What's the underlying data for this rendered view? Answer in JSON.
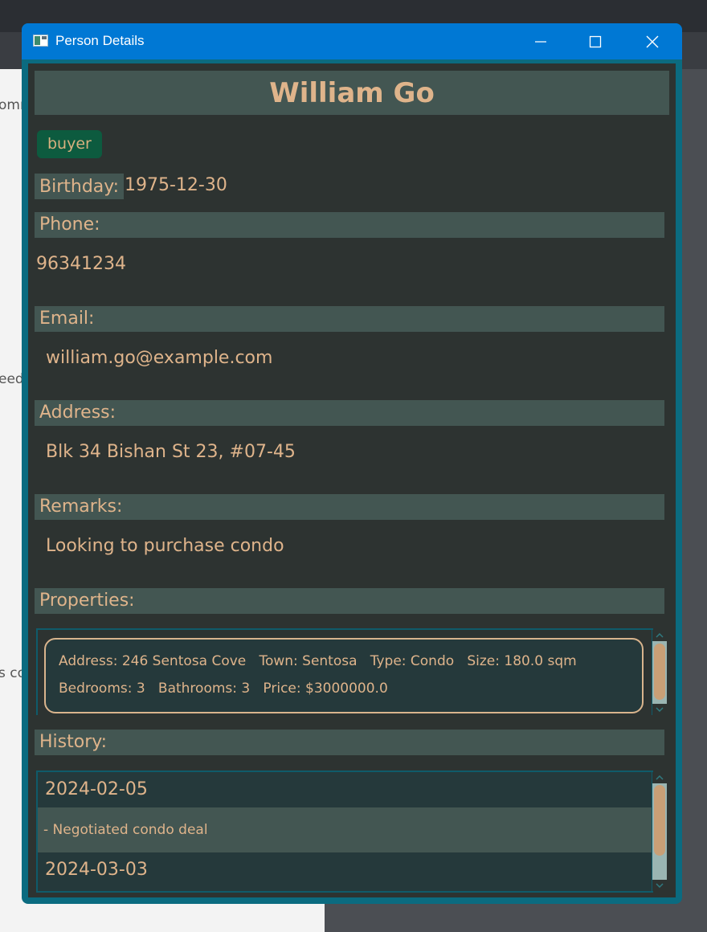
{
  "window": {
    "title": "Person Details"
  },
  "background_fragments": [
    "omm",
    "eed",
    "s co"
  ],
  "person": {
    "name": "William Go",
    "tags": [
      "buyer"
    ],
    "birthday_label": "Birthday:",
    "birthday": "1975-12-30",
    "phone_label": "Phone:",
    "phone": "96341234",
    "email_label": "Email:",
    "email": "william.go@example.com",
    "address_label": "Address:",
    "address": "Blk 34 Bishan St 23, #07-45",
    "remarks_label": "Remarks:",
    "remarks": "Looking to purchase condo",
    "properties_label": "Properties:",
    "properties": [
      {
        "line1": "Address: 246 Sentosa Cove   Town: Sentosa   Type: Condo   Size: 180.0 sqm",
        "line2": "Bedrooms: 3   Bathrooms: 3   Price: $3000000.0"
      }
    ],
    "history_label": "History:",
    "history": [
      {
        "date": "2024-02-05",
        "note": "- Negotiated condo deal"
      },
      {
        "date": "2024-03-03"
      }
    ]
  },
  "colors": {
    "text_accent": "#dfb48b",
    "label_bg": "#435652",
    "content_bg": "#2d3331",
    "tag_bg": "#0d5b3f",
    "titlebar": "#0078d4"
  }
}
